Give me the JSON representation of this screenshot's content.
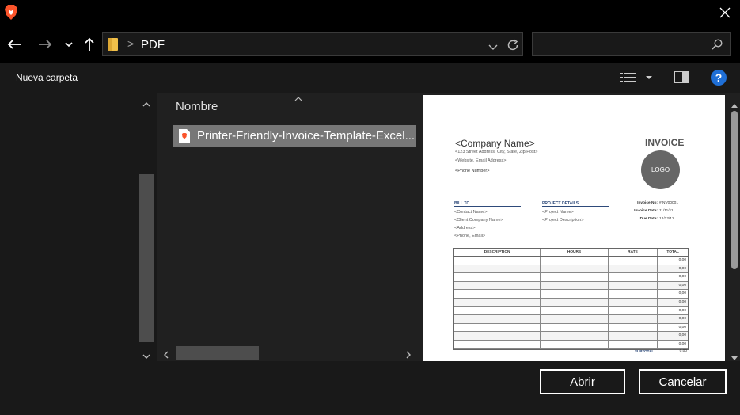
{
  "titlebar": {
    "app_icon": "brave-lion-icon",
    "close_icon": "close-icon"
  },
  "navbar": {
    "back_icon": "arrow-left-icon",
    "forward_icon": "arrow-right-icon",
    "history_icon": "chevron-down-icon",
    "up_icon": "arrow-up-icon",
    "address": {
      "folder_icon": "folder-icon",
      "separator": ">",
      "path": "PDF"
    },
    "search": {
      "placeholder": "",
      "icon": "search-icon"
    }
  },
  "command_bar": {
    "new_folder_label": "Nueva carpeta",
    "view_icon": "details-view-icon",
    "preview_pane_icon": "preview-pane-icon",
    "help_label": "?"
  },
  "file_list": {
    "column_header": "Nombre",
    "files": [
      {
        "name": "Printer-Friendly-Invoice-Template-Excel....",
        "icon": "brave-pdf-icon",
        "selected": true
      }
    ]
  },
  "preview_doc": {
    "company_name": "<Company Name>",
    "address_line": "<123 Street Address, City, State, Zip/Post>",
    "website_line": "<Website, Email Address>",
    "phone_line": "<Phone Number>",
    "title": "INVOICE",
    "logo_text": "LOGO",
    "bill_to": {
      "label": "BILL TO",
      "lines": [
        "<Contact Name>",
        "<Client Company Name>",
        "<Address>",
        "<Phone, Email>"
      ]
    },
    "project": {
      "label": "PROJECT DETAILS",
      "lines": [
        "<Project Name>",
        "<Project Description>"
      ]
    },
    "meta": [
      {
        "label": "Invoice No:",
        "value": "#INV00001"
      },
      {
        "label": "Invoice Date:",
        "value": "11/11/11"
      },
      {
        "label": "Due Date:",
        "value": "12/12/12"
      }
    ],
    "table": {
      "headers": [
        "DESCRIPTION",
        "HOURS",
        "RATE",
        "TOTAL"
      ],
      "row_total": "0,00",
      "row_count": 11
    },
    "subtotal_label": "SUBTOTAL",
    "subtotal_value": "0,00"
  },
  "footer": {
    "open_label": "Abrir",
    "cancel_label": "Cancelar"
  }
}
